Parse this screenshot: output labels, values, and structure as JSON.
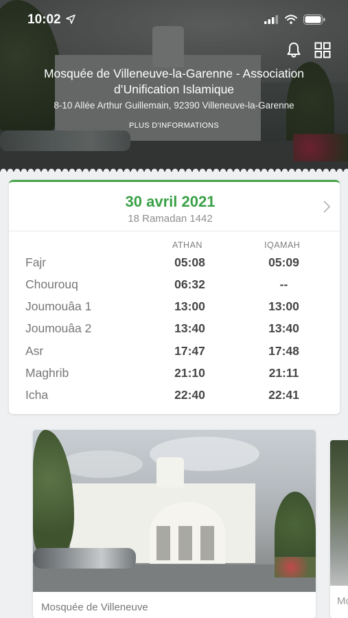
{
  "status_bar": {
    "time": "10:02",
    "icons": [
      "location-arrow-icon",
      "cellular-signal-icon",
      "wifi-icon",
      "battery-icon"
    ]
  },
  "header": {
    "icons": [
      "bell-icon",
      "grid-icon"
    ],
    "mosque_name": "Mosquée de Villeneuve-la-Garenne - Association d’Unification Islamique",
    "address": "8-10 Allée Arthur Guillemain, 92390 Villeneuve-la-Garenne",
    "more_info": "PLUS D'INFORMATIONS"
  },
  "prayer_card": {
    "date": "30 avril 2021",
    "hijri_date": "18 Ramadan 1442",
    "accent_color": "#3aa046",
    "columns": {
      "athan": "ATHAN",
      "iqamah": "IQAMAH"
    },
    "rows": [
      {
        "name": "Fajr",
        "athan": "05:08",
        "iqamah": "05:09"
      },
      {
        "name": "Chourouq",
        "athan": "06:32",
        "iqamah": "--"
      },
      {
        "name": "Joumouâa 1",
        "athan": "13:00",
        "iqamah": "13:00"
      },
      {
        "name": "Joumouâa 2",
        "athan": "13:40",
        "iqamah": "13:40"
      },
      {
        "name": "Asr",
        "athan": "17:47",
        "iqamah": "17:48"
      },
      {
        "name": "Maghrib",
        "athan": "21:10",
        "iqamah": "21:11"
      },
      {
        "name": "Icha",
        "athan": "22:40",
        "iqamah": "22:41"
      }
    ]
  },
  "gallery": [
    {
      "caption": "Mosquée de Villeneuve"
    },
    {
      "caption": "Mo"
    }
  ]
}
